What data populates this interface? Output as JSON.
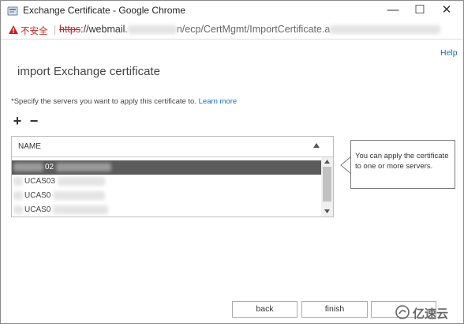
{
  "window": {
    "title": "Exchange Certificate - Google Chrome",
    "controls": {
      "minimize": "—",
      "maximize": "☐",
      "close": "✕"
    }
  },
  "address_bar": {
    "security_label": "不安全",
    "url_scheme": "https",
    "url_host": "://webmail.",
    "url_path_fragment": "n/ecp/CertMgmt/ImportCertificate.a",
    "icons": {
      "security": "warning-triangle-icon"
    }
  },
  "page": {
    "help_link": "Help",
    "title": "import Exchange certificate",
    "instruction": "*Specify the servers you want to apply this certificate to.",
    "learn_more": "Learn more",
    "add_icon": "+",
    "remove_icon": "−"
  },
  "server_list": {
    "column_header": "NAME",
    "rows": [
      {
        "name": "02",
        "selected": true
      },
      {
        "name": "UCAS03",
        "selected": false
      },
      {
        "name": "UCAS0",
        "selected": false
      },
      {
        "name": "UCAS0",
        "selected": false
      }
    ]
  },
  "tooltip": {
    "text": "You can apply the certificate to one or more servers."
  },
  "footer": {
    "back": "back",
    "finish": "finish",
    "cancel": ""
  },
  "watermark": {
    "text": "亿速云"
  },
  "colors": {
    "link": "#1e6bb8",
    "insecure": "#c5221f",
    "selected_row": "#5b5b5b"
  }
}
